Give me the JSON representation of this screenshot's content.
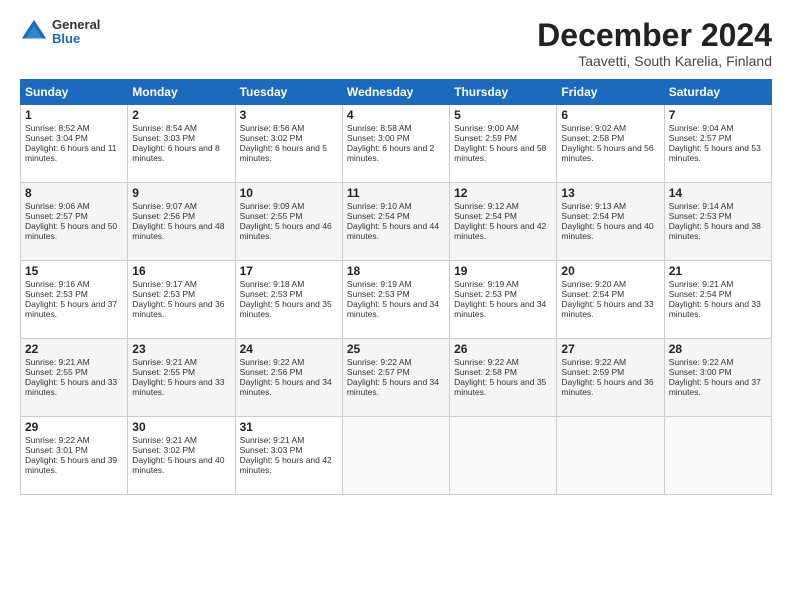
{
  "header": {
    "logo": {
      "general": "General",
      "blue": "Blue"
    },
    "title": "December 2024",
    "subtitle": "Taavetti, South Karelia, Finland"
  },
  "columns": [
    "Sunday",
    "Monday",
    "Tuesday",
    "Wednesday",
    "Thursday",
    "Friday",
    "Saturday"
  ],
  "weeks": [
    [
      {
        "day": "1",
        "sunrise": "Sunrise: 8:52 AM",
        "sunset": "Sunset: 3:04 PM",
        "daylight": "Daylight: 6 hours and 11 minutes."
      },
      {
        "day": "2",
        "sunrise": "Sunrise: 8:54 AM",
        "sunset": "Sunset: 3:03 PM",
        "daylight": "Daylight: 6 hours and 8 minutes."
      },
      {
        "day": "3",
        "sunrise": "Sunrise: 8:56 AM",
        "sunset": "Sunset: 3:02 PM",
        "daylight": "Daylight: 6 hours and 5 minutes."
      },
      {
        "day": "4",
        "sunrise": "Sunrise: 8:58 AM",
        "sunset": "Sunset: 3:00 PM",
        "daylight": "Daylight: 6 hours and 2 minutes."
      },
      {
        "day": "5",
        "sunrise": "Sunrise: 9:00 AM",
        "sunset": "Sunset: 2:59 PM",
        "daylight": "Daylight: 5 hours and 58 minutes."
      },
      {
        "day": "6",
        "sunrise": "Sunrise: 9:02 AM",
        "sunset": "Sunset: 2:58 PM",
        "daylight": "Daylight: 5 hours and 56 minutes."
      },
      {
        "day": "7",
        "sunrise": "Sunrise: 9:04 AM",
        "sunset": "Sunset: 2:57 PM",
        "daylight": "Daylight: 5 hours and 53 minutes."
      }
    ],
    [
      {
        "day": "8",
        "sunrise": "Sunrise: 9:06 AM",
        "sunset": "Sunset: 2:57 PM",
        "daylight": "Daylight: 5 hours and 50 minutes."
      },
      {
        "day": "9",
        "sunrise": "Sunrise: 9:07 AM",
        "sunset": "Sunset: 2:56 PM",
        "daylight": "Daylight: 5 hours and 48 minutes."
      },
      {
        "day": "10",
        "sunrise": "Sunrise: 9:09 AM",
        "sunset": "Sunset: 2:55 PM",
        "daylight": "Daylight: 5 hours and 46 minutes."
      },
      {
        "day": "11",
        "sunrise": "Sunrise: 9:10 AM",
        "sunset": "Sunset: 2:54 PM",
        "daylight": "Daylight: 5 hours and 44 minutes."
      },
      {
        "day": "12",
        "sunrise": "Sunrise: 9:12 AM",
        "sunset": "Sunset: 2:54 PM",
        "daylight": "Daylight: 5 hours and 42 minutes."
      },
      {
        "day": "13",
        "sunrise": "Sunrise: 9:13 AM",
        "sunset": "Sunset: 2:54 PM",
        "daylight": "Daylight: 5 hours and 40 minutes."
      },
      {
        "day": "14",
        "sunrise": "Sunrise: 9:14 AM",
        "sunset": "Sunset: 2:53 PM",
        "daylight": "Daylight: 5 hours and 38 minutes."
      }
    ],
    [
      {
        "day": "15",
        "sunrise": "Sunrise: 9:16 AM",
        "sunset": "Sunset: 2:53 PM",
        "daylight": "Daylight: 5 hours and 37 minutes."
      },
      {
        "day": "16",
        "sunrise": "Sunrise: 9:17 AM",
        "sunset": "Sunset: 2:53 PM",
        "daylight": "Daylight: 5 hours and 36 minutes."
      },
      {
        "day": "17",
        "sunrise": "Sunrise: 9:18 AM",
        "sunset": "Sunset: 2:53 PM",
        "daylight": "Daylight: 5 hours and 35 minutes."
      },
      {
        "day": "18",
        "sunrise": "Sunrise: 9:19 AM",
        "sunset": "Sunset: 2:53 PM",
        "daylight": "Daylight: 5 hours and 34 minutes."
      },
      {
        "day": "19",
        "sunrise": "Sunrise: 9:19 AM",
        "sunset": "Sunset: 2:53 PM",
        "daylight": "Daylight: 5 hours and 34 minutes."
      },
      {
        "day": "20",
        "sunrise": "Sunrise: 9:20 AM",
        "sunset": "Sunset: 2:54 PM",
        "daylight": "Daylight: 5 hours and 33 minutes."
      },
      {
        "day": "21",
        "sunrise": "Sunrise: 9:21 AM",
        "sunset": "Sunset: 2:54 PM",
        "daylight": "Daylight: 5 hours and 33 minutes."
      }
    ],
    [
      {
        "day": "22",
        "sunrise": "Sunrise: 9:21 AM",
        "sunset": "Sunset: 2:55 PM",
        "daylight": "Daylight: 5 hours and 33 minutes."
      },
      {
        "day": "23",
        "sunrise": "Sunrise: 9:21 AM",
        "sunset": "Sunset: 2:55 PM",
        "daylight": "Daylight: 5 hours and 33 minutes."
      },
      {
        "day": "24",
        "sunrise": "Sunrise: 9:22 AM",
        "sunset": "Sunset: 2:56 PM",
        "daylight": "Daylight: 5 hours and 34 minutes."
      },
      {
        "day": "25",
        "sunrise": "Sunrise: 9:22 AM",
        "sunset": "Sunset: 2:57 PM",
        "daylight": "Daylight: 5 hours and 34 minutes."
      },
      {
        "day": "26",
        "sunrise": "Sunrise: 9:22 AM",
        "sunset": "Sunset: 2:58 PM",
        "daylight": "Daylight: 5 hours and 35 minutes."
      },
      {
        "day": "27",
        "sunrise": "Sunrise: 9:22 AM",
        "sunset": "Sunset: 2:59 PM",
        "daylight": "Daylight: 5 hours and 36 minutes."
      },
      {
        "day": "28",
        "sunrise": "Sunrise: 9:22 AM",
        "sunset": "Sunset: 3:00 PM",
        "daylight": "Daylight: 5 hours and 37 minutes."
      }
    ],
    [
      {
        "day": "29",
        "sunrise": "Sunrise: 9:22 AM",
        "sunset": "Sunset: 3:01 PM",
        "daylight": "Daylight: 5 hours and 39 minutes."
      },
      {
        "day": "30",
        "sunrise": "Sunrise: 9:21 AM",
        "sunset": "Sunset: 3:02 PM",
        "daylight": "Daylight: 5 hours and 40 minutes."
      },
      {
        "day": "31",
        "sunrise": "Sunrise: 9:21 AM",
        "sunset": "Sunset: 3:03 PM",
        "daylight": "Daylight: 5 hours and 42 minutes."
      },
      null,
      null,
      null,
      null
    ]
  ]
}
